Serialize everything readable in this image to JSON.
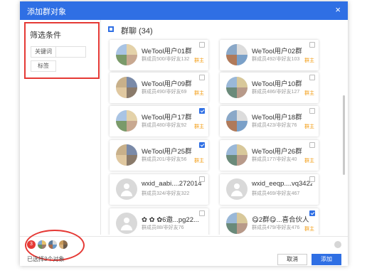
{
  "dialog": {
    "title": "添加群对象",
    "close_glyph": "×"
  },
  "filter": {
    "title": "筛选条件",
    "keyword_label": "关键词",
    "keyword_value": "",
    "tag_label": "标签"
  },
  "header": {
    "group_label": "群聊 (34)"
  },
  "groups": [
    {
      "name": "WeTool用户01群",
      "meta": "群成员500/非好友132",
      "badge": "群主",
      "checked": false,
      "avatar": "photo"
    },
    {
      "name": "WeTool用户02群",
      "meta": "群成员492/非好友103",
      "badge": "群主",
      "checked": false,
      "avatar": "photo"
    },
    {
      "name": "WeTool用户09群",
      "meta": "群成员490/非好友69",
      "badge": "群主",
      "checked": false,
      "avatar": "photo"
    },
    {
      "name": "WeTool用户10群",
      "meta": "群成员486/非好友127",
      "badge": "群主",
      "checked": false,
      "avatar": "photo"
    },
    {
      "name": "WeTool用户17群",
      "meta": "群成员480/非好友92",
      "badge": "群主",
      "checked": true,
      "avatar": "photo"
    },
    {
      "name": "WeTool用户18群",
      "meta": "群成员423/非好友76",
      "badge": "群主",
      "checked": false,
      "avatar": "photo"
    },
    {
      "name": "WeTool用户25群",
      "meta": "群成员201/非好友56",
      "badge": "群主",
      "checked": true,
      "avatar": "photo"
    },
    {
      "name": "WeTool用户26群",
      "meta": "群成员177/非好友40",
      "badge": "群主",
      "checked": false,
      "avatar": "photo"
    },
    {
      "name": "wxid_aabi....272014...",
      "meta": "群成员324/非好友322",
      "badge": "",
      "checked": false,
      "avatar": "default"
    },
    {
      "name": "wxid_eeqp....vq3422...",
      "meta": "群成员469/非好友467",
      "badge": "",
      "checked": false,
      "avatar": "default"
    },
    {
      "name": "✿ ✿ ✿6邀...pg22...",
      "meta": "群成员88/非好友76",
      "badge": "",
      "checked": false,
      "avatar": "default"
    },
    {
      "name": "😋2群😋...喜合伙人",
      "meta": "群成员479/非好友476",
      "badge": "群主",
      "checked": true,
      "avatar": "photo"
    }
  ],
  "footer": {
    "selected_count": "3",
    "selected_text": "已选择3个对象",
    "cancel_label": "取消",
    "add_label": "添加"
  },
  "colors": {
    "primary": "#2f6fe4",
    "highlight_red": "#e53935",
    "owner_badge": "#f39c12"
  }
}
